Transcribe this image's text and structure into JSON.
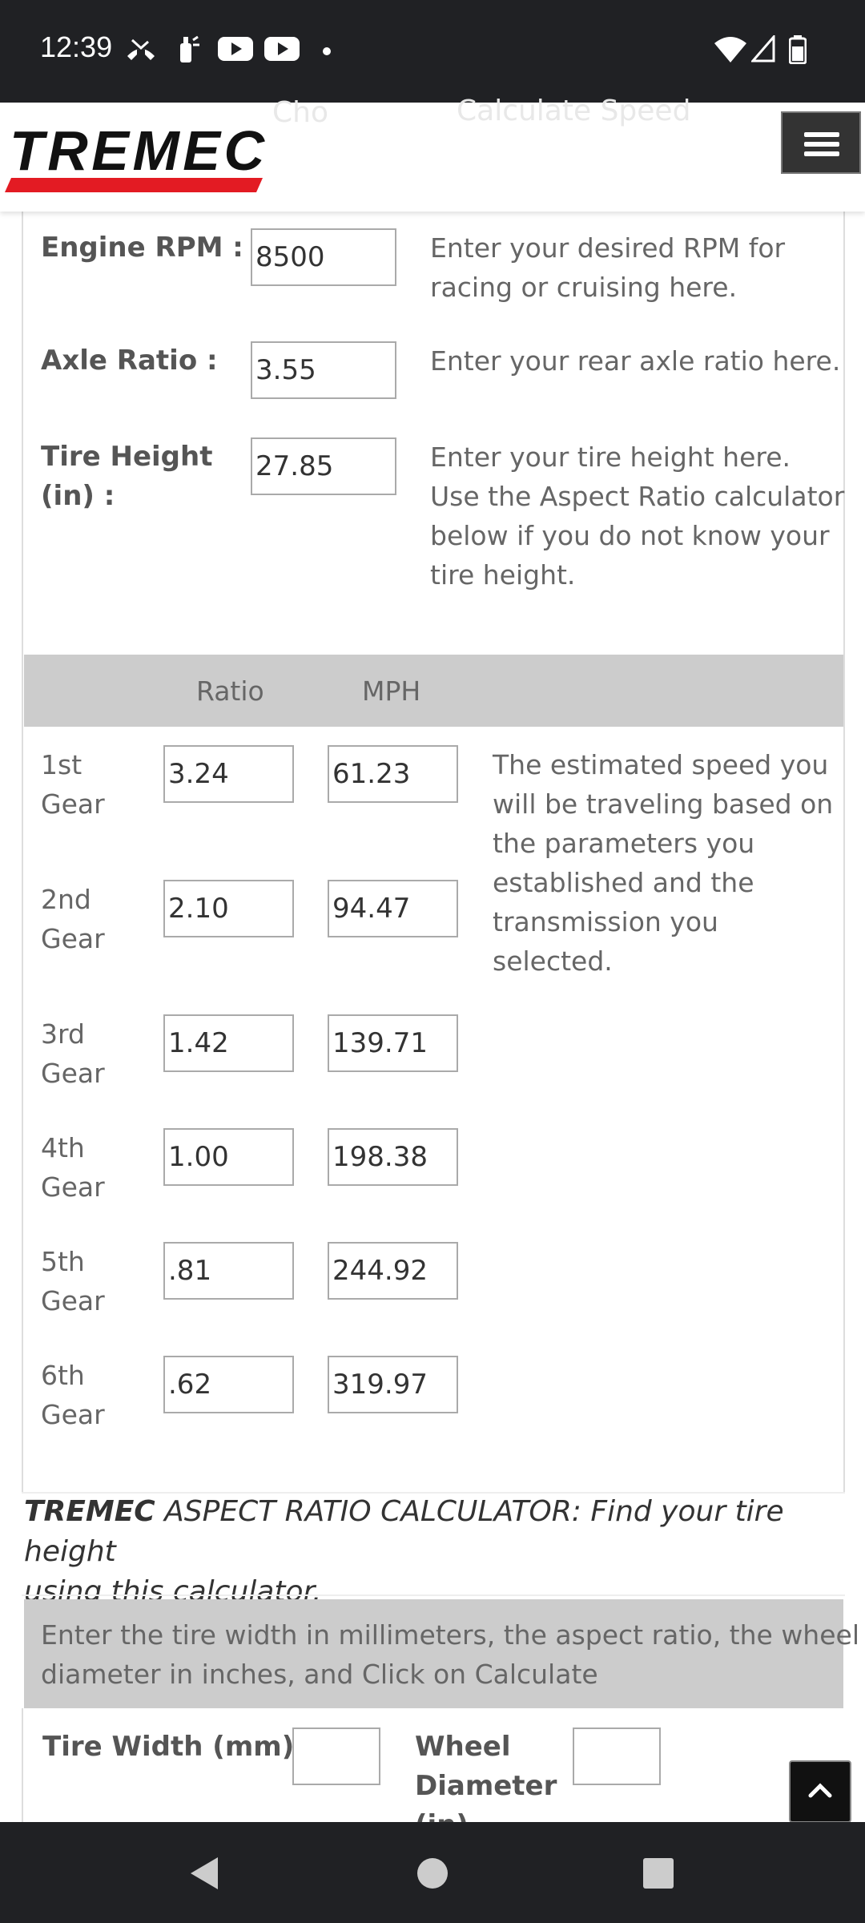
{
  "status_bar": {
    "time": "12:39"
  },
  "header": {
    "logo_text": "TREMEC",
    "ghost_tab_1": "Cho",
    "ghost_tab_2": "Calculate Speed",
    "menu_icon": "hamburger-icon"
  },
  "inputs": {
    "engine_rpm": {
      "label": "Engine RPM :",
      "value": "8500",
      "help": [
        "Enter your desired RPM for",
        "racing or cruising here."
      ]
    },
    "axle_ratio": {
      "label": "Axle Ratio :",
      "value": "3.55",
      "help": [
        "Enter your rear axle ratio here."
      ]
    },
    "tire_height": {
      "label": [
        "Tire Height",
        "(in) :"
      ],
      "value": "27.85",
      "help": [
        "Enter your tire height here.",
        "Use the Aspect Ratio calculator",
        "below if you do not know your",
        "tire height."
      ]
    }
  },
  "gear_table": {
    "col_ratio": "Ratio",
    "col_mph": "MPH",
    "note": [
      "The estimated speed you",
      "will be traveling based on",
      "the parameters you",
      "established and the",
      "transmission you",
      "selected."
    ],
    "rows": [
      {
        "line1": "1st",
        "line2": "Gear",
        "ratio": "3.24",
        "mph": "61.23"
      },
      {
        "line1": "2nd",
        "line2": "Gear",
        "ratio": "2.10",
        "mph": "94.47"
      },
      {
        "line1": "3rd",
        "line2": "Gear",
        "ratio": "1.42",
        "mph": "139.71"
      },
      {
        "line1": "4th",
        "line2": "Gear",
        "ratio": "1.00",
        "mph": "198.38"
      },
      {
        "line1": "5th",
        "line2": "Gear",
        "ratio": ".81",
        "mph": "244.92"
      },
      {
        "line1": "6th",
        "line2": "Gear",
        "ratio": ".62",
        "mph": "319.97"
      }
    ]
  },
  "aspect_calc": {
    "title_brand": "TREMEC",
    "title_rest": " ASPECT RATIO CALCULATOR: Find your tire height",
    "title_line2": "using this calculator.",
    "instructions": [
      "Enter the tire width in millimeters, the aspect ratio, the wheel",
      "diameter in inches, and Click on Calculate"
    ],
    "tire_width_label": "Tire Width (mm)",
    "tire_width_value": "",
    "wheel_diameter_label": [
      "Wheel",
      "Diameter",
      "(in)"
    ],
    "wheel_diameter_value": ""
  },
  "colors": {
    "brand_red": "#e31b23",
    "band_gray": "#cccccc",
    "dark": "#202124"
  }
}
